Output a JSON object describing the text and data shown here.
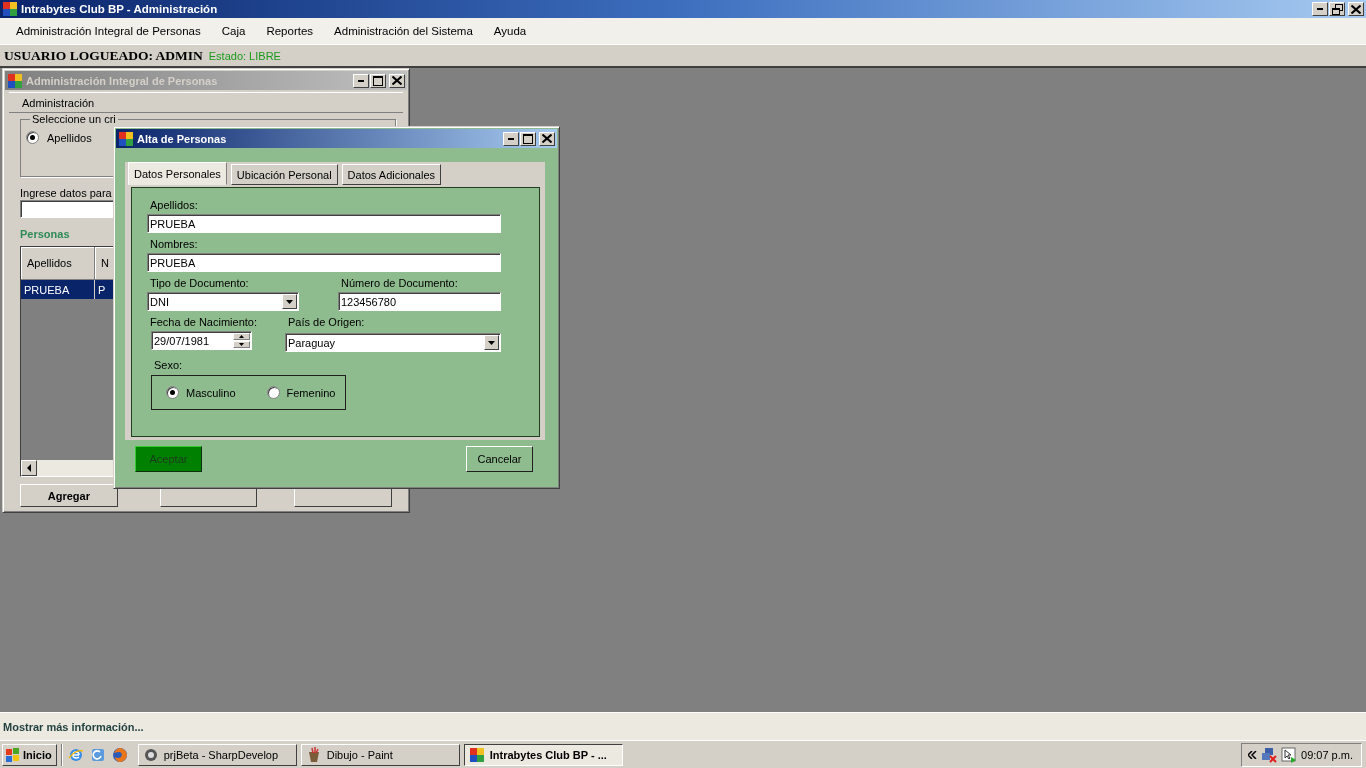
{
  "window": {
    "title": "Intrabytes Club BP - Administración"
  },
  "menu": [
    {
      "label": "Administración Integral de Personas"
    },
    {
      "label": "Caja"
    },
    {
      "label": "Reportes"
    },
    {
      "label": "Administración del Sistema"
    },
    {
      "label": "Ayuda"
    }
  ],
  "user_bar": {
    "user": "USUARIO LOGUEADO: ADMIN",
    "status": "Estado: LIBRE"
  },
  "personas_window": {
    "title": "Administración Integral de Personas",
    "active": false,
    "section": "Administración",
    "criteria_group": "Seleccione un cri",
    "criteria": [
      {
        "label": "Apellidos",
        "selected": true
      }
    ],
    "search_label": "Ingrese datos para",
    "list_title": "Personas",
    "table": {
      "columns": [
        "Apellidos",
        "N"
      ],
      "rows": [
        {
          "cells": [
            "PRUEBA",
            "P"
          ],
          "selected": true
        }
      ]
    },
    "buttons": [
      {
        "label": "Agregar"
      }
    ]
  },
  "alta_window": {
    "title": "Alta de Personas",
    "active": true,
    "tabs": [
      {
        "label": "Datos Personales",
        "selected": true
      },
      {
        "label": "Ubicación Personal",
        "selected": false
      },
      {
        "label": "Datos Adicionales",
        "selected": false
      }
    ],
    "apellidos": {
      "label": "Apellidos:",
      "value": "PRUEBA"
    },
    "nombres": {
      "label": "Nombres:",
      "value": "PRUEBA"
    },
    "tipo_documento": {
      "label": "Tipo de Documento:",
      "value": "DNI"
    },
    "numero_documento": {
      "label": "Número de Documento:",
      "value": "123456780"
    },
    "fecha_nacimiento": {
      "label": "Fecha de Nacimiento:",
      "value": "29/07/1981"
    },
    "pais_origen": {
      "label": "País de Origen:",
      "value": "Paraguay"
    },
    "sexo": {
      "label": "Sexo:",
      "options": [
        {
          "label": "Masculino",
          "selected": true
        },
        {
          "label": "Femenino",
          "selected": false
        }
      ]
    },
    "buttons": [
      {
        "kind": "accept",
        "label": "Aceptar"
      },
      {
        "kind": "cancel",
        "label": "Cancelar"
      }
    ]
  },
  "status_bar": {
    "text": "Mostrar más información..."
  },
  "taskbar": {
    "start": "Inicio",
    "tasks": [
      {
        "label": "prjBeta - SharpDevelop",
        "selected": false
      },
      {
        "label": "Dibujo - Paint",
        "selected": false
      },
      {
        "label": "Intrabytes Club BP - ...",
        "selected": true
      }
    ],
    "clock": "09:07 p.m."
  }
}
